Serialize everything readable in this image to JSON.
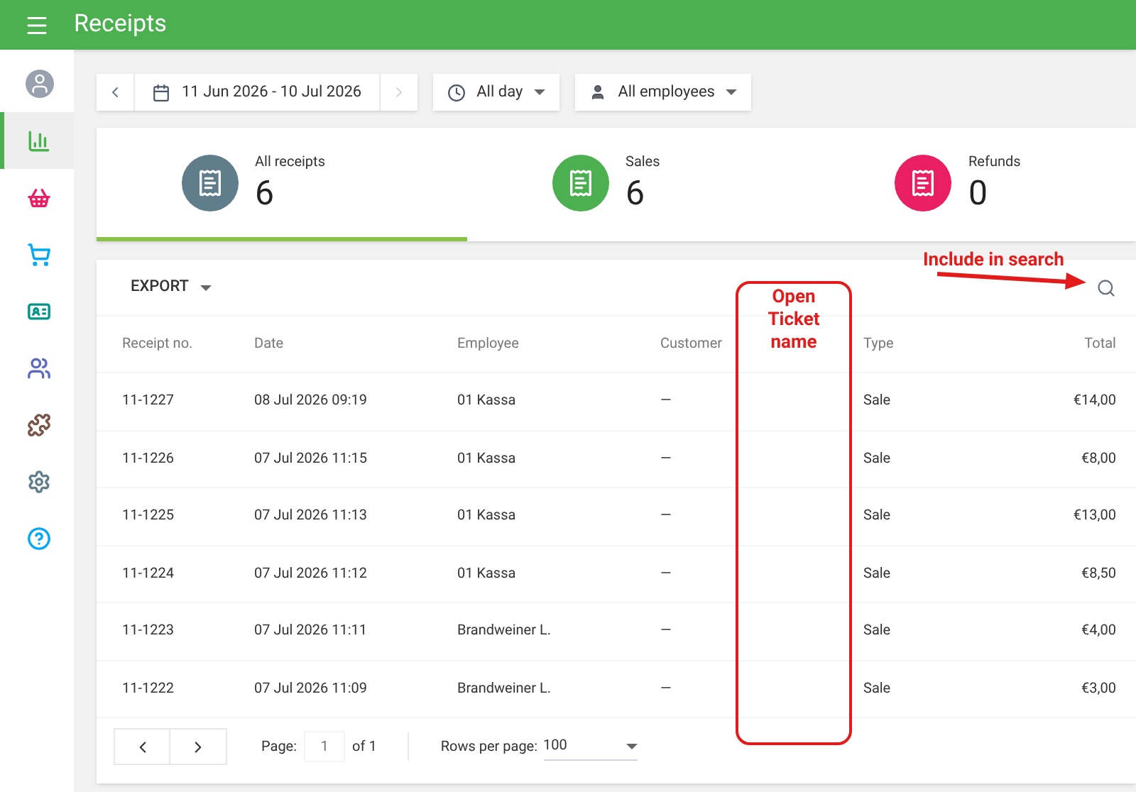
{
  "app_bar": {
    "title": "Receipts"
  },
  "sidebar": {
    "items": [
      {
        "kind": "account",
        "selected": false
      },
      {
        "kind": "reports",
        "selected": true
      },
      {
        "kind": "items",
        "selected": false
      },
      {
        "kind": "inventory",
        "selected": false
      },
      {
        "kind": "customers",
        "selected": false
      },
      {
        "kind": "employees",
        "selected": false
      },
      {
        "kind": "integrations",
        "selected": false
      },
      {
        "kind": "settings",
        "selected": false
      },
      {
        "kind": "help",
        "selected": false
      }
    ]
  },
  "filters": {
    "date_range": "11 Jun 2026 - 10 Jul 2026",
    "time": "All day",
    "employee": "All employees"
  },
  "summary": [
    {
      "label": "All receipts",
      "value": "6",
      "kind": "all",
      "selected": true
    },
    {
      "label": "Sales",
      "value": "6",
      "kind": "sales",
      "selected": false
    },
    {
      "label": "Refunds",
      "value": "0",
      "kind": "refunds",
      "selected": false
    }
  ],
  "table": {
    "export": "EXPORT",
    "columns": [
      "Receipt no.",
      "Date",
      "Employee",
      "Customer",
      "Type",
      "Total"
    ],
    "rows": [
      [
        "11-1227",
        "08 Jul 2026 09:19",
        "01 Kassa",
        "—",
        "Sale",
        "€14,00"
      ],
      [
        "11-1226",
        "07 Jul 2026 11:15",
        "01 Kassa",
        "—",
        "Sale",
        "€8,00"
      ],
      [
        "11-1225",
        "07 Jul 2026 11:13",
        "01 Kassa",
        "—",
        "Sale",
        "€13,00"
      ],
      [
        "11-1224",
        "07 Jul 2026 11:12",
        "01 Kassa",
        "—",
        "Sale",
        "€8,50"
      ],
      [
        "11-1223",
        "07 Jul 2026 11:11",
        "Brandweiner L.",
        "—",
        "Sale",
        "€4,00"
      ],
      [
        "11-1222",
        "07 Jul 2026 11:09",
        "Brandweiner L.",
        "—",
        "Sale",
        "€3,00"
      ]
    ]
  },
  "pagination": {
    "page_label": "Page:",
    "page": "1",
    "of": "of 1",
    "rows_label": "Rows per page:",
    "rows_per_page": "100"
  },
  "annotations": {
    "column_note": "Open Ticket name",
    "search_note": "Include in search"
  }
}
